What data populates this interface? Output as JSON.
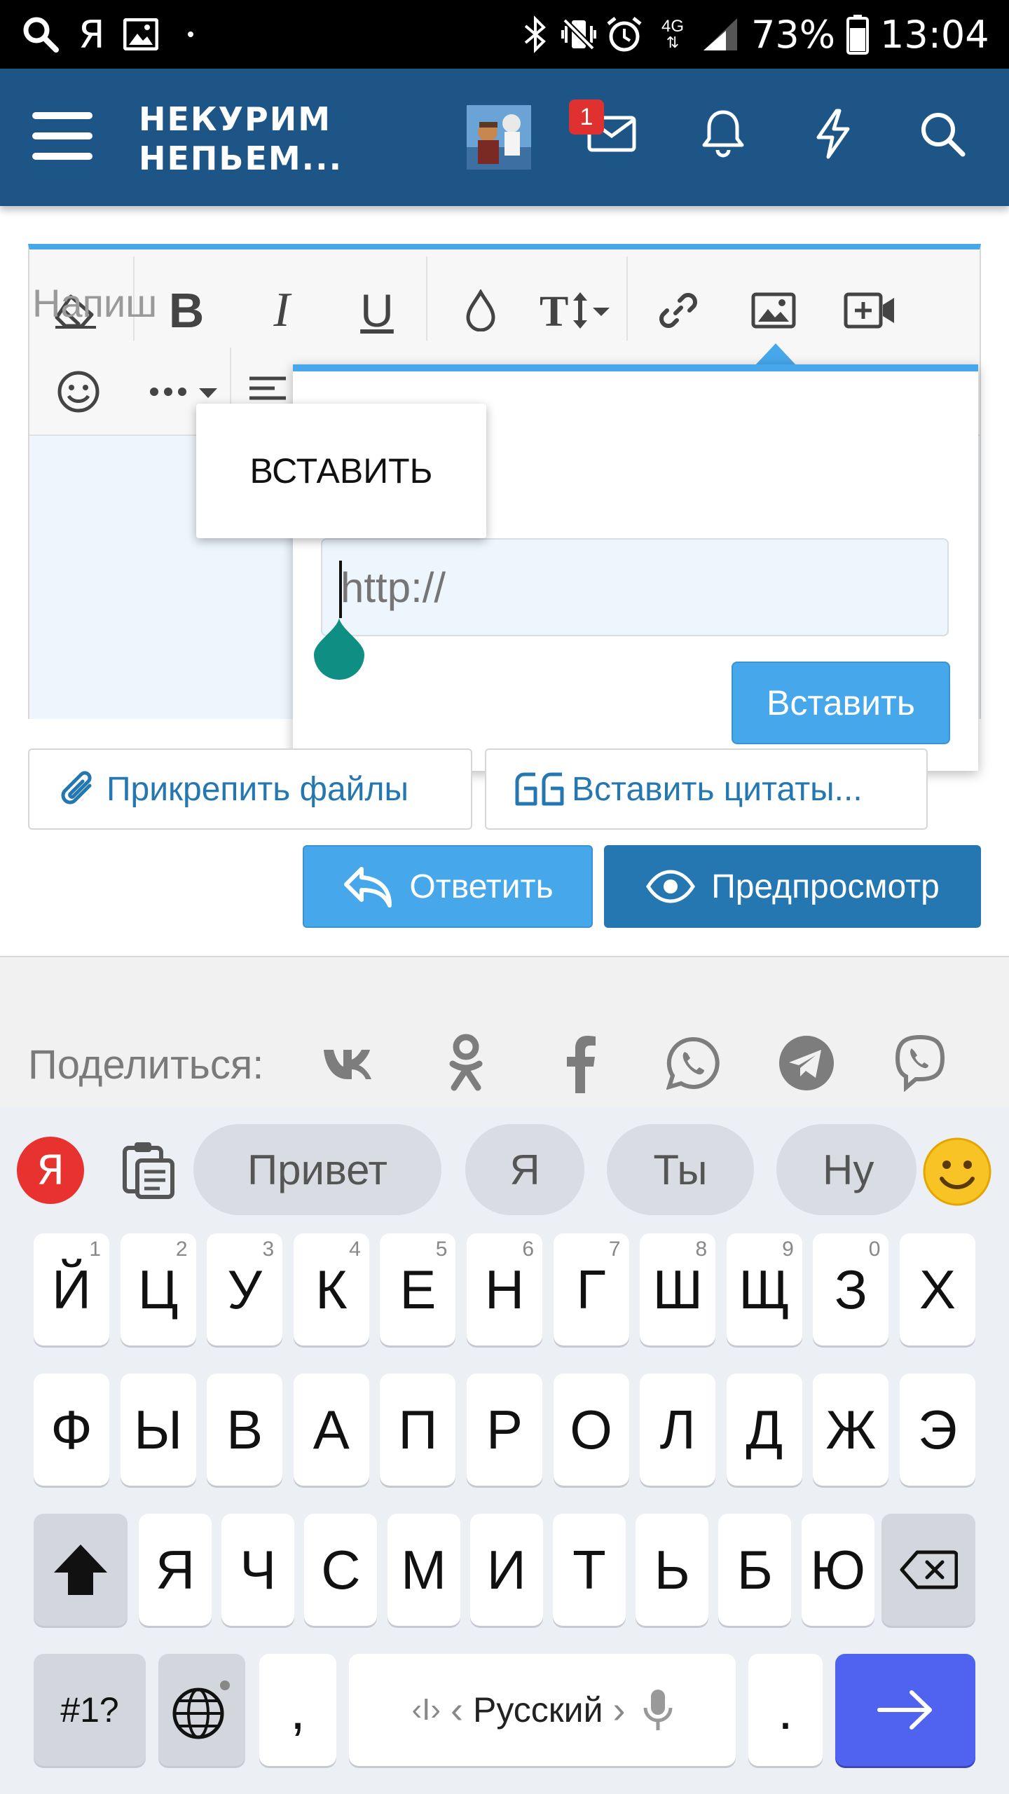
{
  "status_bar": {
    "battery": "73%",
    "time": "13:04",
    "network": "4G"
  },
  "header": {
    "logo_line1": "НЕКУРИМ",
    "logo_line2": "НЕПЬЕМ...",
    "messages_badge": "1",
    "accent_color": "#1e5587"
  },
  "editor": {
    "placeholder": "Напиш"
  },
  "link_popup": {
    "url_placeholder": "http://",
    "insert_label": "Вставить"
  },
  "context_menu": {
    "paste_label": "ВСТАВИТЬ"
  },
  "actions": {
    "attach_label": "Прикрепить файлы",
    "quotes_label": "Вставить цитаты...",
    "reply_label": "Ответить",
    "preview_label": "Предпросмотр"
  },
  "share": {
    "label": "Поделиться:"
  },
  "keyboard": {
    "suggestions": [
      "Привет",
      "Я",
      "Ты",
      "Ну"
    ],
    "row1": [
      {
        "k": "Й",
        "h": "1"
      },
      {
        "k": "Ц",
        "h": "2"
      },
      {
        "k": "У",
        "h": "3"
      },
      {
        "k": "К",
        "h": "4"
      },
      {
        "k": "Е",
        "h": "5"
      },
      {
        "k": "Н",
        "h": "6"
      },
      {
        "k": "Г",
        "h": "7"
      },
      {
        "k": "Ш",
        "h": "8"
      },
      {
        "k": "Щ",
        "h": "9"
      },
      {
        "k": "З",
        "h": "0"
      },
      {
        "k": "Х",
        "h": ""
      }
    ],
    "row2": [
      "Ф",
      "Ы",
      "В",
      "А",
      "П",
      "Р",
      "О",
      "Л",
      "Д",
      "Ж",
      "Э"
    ],
    "row3": [
      "Я",
      "Ч",
      "С",
      "М",
      "И",
      "Т",
      "Ь",
      "Б",
      "Ю"
    ],
    "symbols_label": "#1?",
    "comma_label": ",",
    "period_label": ".",
    "space_label": "Русский",
    "enter_color": "#4f63f0"
  }
}
